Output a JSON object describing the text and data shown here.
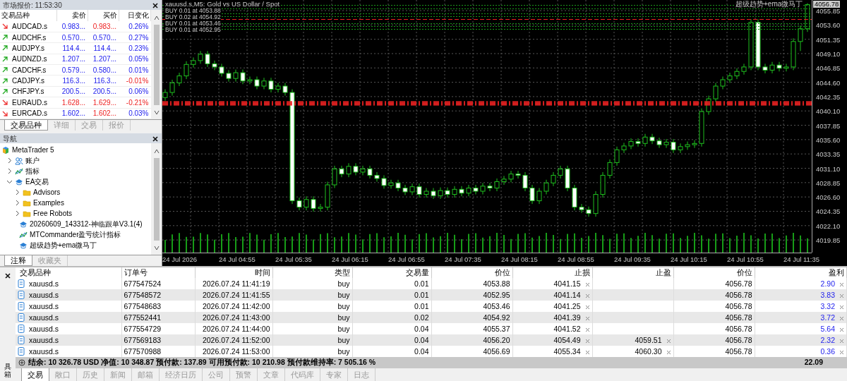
{
  "market_watch": {
    "title": "市场报价: 11:53:30",
    "columns": [
      "交易品种",
      "卖价",
      "买价",
      "日变化"
    ],
    "rows": [
      {
        "symbol": "AUDCAD.s",
        "falling": true,
        "bid": "0.983...",
        "bid_down": false,
        "ask": "0.983...",
        "ask_down": true,
        "change": "0.26%",
        "change_down": false
      },
      {
        "symbol": "AUDCHF.s",
        "falling": false,
        "bid": "0.570...",
        "bid_down": false,
        "ask": "0.570...",
        "ask_down": false,
        "change": "0.27%",
        "change_down": false
      },
      {
        "symbol": "AUDJPY.s",
        "falling": false,
        "bid": "114.4...",
        "bid_down": false,
        "ask": "114.4...",
        "ask_down": false,
        "change": "0.23%",
        "change_down": false
      },
      {
        "symbol": "AUDNZD.s",
        "falling": false,
        "bid": "1.207...",
        "bid_down": false,
        "ask": "1.207...",
        "ask_down": false,
        "change": "0.05%",
        "change_down": false
      },
      {
        "symbol": "CADCHF.s",
        "falling": false,
        "bid": "0.579...",
        "bid_down": false,
        "ask": "0.580...",
        "ask_down": false,
        "change": "0.01%",
        "change_down": false
      },
      {
        "symbol": "CADJPY.s",
        "falling": false,
        "bid": "116.3...",
        "bid_down": false,
        "ask": "116.3...",
        "ask_down": false,
        "change": "-0.01%",
        "change_down": true
      },
      {
        "symbol": "CHFJPY.s",
        "falling": false,
        "bid": "200.5...",
        "bid_down": false,
        "ask": "200.5...",
        "ask_down": false,
        "change": "0.06%",
        "change_down": false
      },
      {
        "symbol": "EURAUD.s",
        "falling": true,
        "bid": "1.628...",
        "bid_down": true,
        "ask": "1.629...",
        "ask_down": true,
        "change": "-0.21%",
        "change_down": true
      },
      {
        "symbol": "EURCAD.s",
        "falling": true,
        "bid": "1.602...",
        "bid_down": false,
        "ask": "1.602...",
        "ask_down": true,
        "change": "0.03%",
        "change_down": false
      }
    ],
    "tabs": [
      {
        "label": "交易品种",
        "selected": true
      },
      {
        "label": "详细",
        "selected": false
      },
      {
        "label": "交易",
        "selected": false
      },
      {
        "label": "报价",
        "selected": false
      }
    ]
  },
  "navigator": {
    "title": "导航",
    "tree": [
      {
        "label": "MetaTrader 5",
        "kind": "root",
        "children": [
          {
            "label": "账户",
            "kind": "accounts",
            "expanded": false
          },
          {
            "label": "指标",
            "kind": "indicator",
            "expanded": false
          },
          {
            "label": "EA交易",
            "kind": "expert",
            "expanded": true,
            "children": [
              {
                "label": "Advisors",
                "kind": "folder",
                "expanded": false
              },
              {
                "label": "Examples",
                "kind": "folder",
                "expanded": false
              },
              {
                "label": "Free Robots",
                "kind": "folder",
                "expanded": false
              },
              {
                "label": "20260609_143312-神临跟单V3.1(4)",
                "kind": "expert"
              },
              {
                "label": "MTCommander盈亏统计指标",
                "kind": "indicator"
              },
              {
                "label": "超级趋势+ema微马丁",
                "kind": "expert"
              }
            ]
          }
        ]
      }
    ],
    "tabs": [
      {
        "label": "注释",
        "selected": true
      },
      {
        "label": "收藏夹",
        "selected": false
      }
    ]
  },
  "chart": {
    "title": "xauusd.s,M5: Gold vs US Dollar / Spot",
    "trade_labels": [
      "BUY 0.01 at 4053.88",
      "BUY 0.02 at 4054.92",
      "BUY 0.01 at 4053.46",
      "BUY 0.01 at 4052.95"
    ],
    "expert_name": "超级趋势+ema微马丁",
    "price_tag": "4056.78",
    "time_labels": [
      "24 Jul 2026",
      "24 Jul 04:55",
      "24 Jul 05:35",
      "24 Jul 06:15",
      "24 Jul 06:55",
      "24 Jul 07:35",
      "24 Jul 08:15",
      "24 Jul 08:55",
      "24 Jul 09:35",
      "24 Jul 10:15",
      "24 Jul 10:55",
      "24 Jul 11:35"
    ],
    "chart_data": {
      "type": "candlestick",
      "grid": true,
      "ylim": [
        4017.87,
        4057.51
      ],
      "yticks": [
        {
          "value": 4055.85,
          "label": "4055.85"
        },
        {
          "value": 4053.6,
          "label": "4053.60"
        },
        {
          "value": 4051.35,
          "label": "4051.35"
        },
        {
          "value": 4049.1,
          "label": "4049.10"
        },
        {
          "value": 4046.85,
          "label": "4046.85"
        },
        {
          "value": 4044.6,
          "label": "4044.60"
        },
        {
          "value": 4042.35,
          "label": "4042.35"
        },
        {
          "value": 4040.1,
          "label": "4040.10"
        },
        {
          "value": 4037.85,
          "label": "4037.85"
        },
        {
          "value": 4035.6,
          "label": "4035.60"
        },
        {
          "value": 4033.35,
          "label": "4033.35"
        },
        {
          "value": 4031.1,
          "label": "4031.10"
        },
        {
          "value": 4028.85,
          "label": "4028.85"
        },
        {
          "value": 4026.6,
          "label": "4026.60"
        },
        {
          "value": 4024.35,
          "label": "4024.35"
        },
        {
          "value": 4022.1,
          "label": "4022.10"
        },
        {
          "value": 4019.85,
          "label": "4019.85"
        }
      ],
      "ohlc": [
        [
          4042.2,
          4043.5,
          4041.7,
          4043.0
        ],
        [
          4043.0,
          4045.0,
          4042.5,
          4044.5
        ],
        [
          4044.5,
          4046.1,
          4044.0,
          4045.6
        ],
        [
          4045.6,
          4047.9,
          4045.1,
          4047.4
        ],
        [
          4047.4,
          4048.5,
          4046.9,
          4048.0
        ],
        [
          4048.0,
          4049.5,
          4047.5,
          4049.0
        ],
        [
          4049.0,
          4049.5,
          4047.0,
          4047.5
        ],
        [
          4047.5,
          4048.0,
          4046.5,
          4047.0
        ],
        [
          4047.0,
          4047.5,
          4045.5,
          4046.0
        ],
        [
          4046.0,
          4046.5,
          4044.7,
          4045.2
        ],
        [
          4045.2,
          4046.6,
          4044.7,
          4046.1
        ],
        [
          4046.1,
          4046.6,
          4044.3,
          4044.8
        ],
        [
          4044.8,
          4045.5,
          4044.3,
          4045.0
        ],
        [
          4045.0,
          4045.5,
          4043.5,
          4044.0
        ],
        [
          4044.0,
          4045.3,
          4043.5,
          4044.8
        ],
        [
          4044.8,
          4045.3,
          4043.0,
          4043.5
        ],
        [
          4043.5,
          4044.5,
          4043.0,
          4044.0
        ],
        [
          4044.0,
          4044.5,
          4042.5,
          4043.0
        ],
        [
          4043.0,
          4043.5,
          4025.5,
          4026.0
        ],
        [
          4026.0,
          4026.5,
          4024.5,
          4025.0
        ],
        [
          4025.0,
          4026.7,
          4024.5,
          4026.2
        ],
        [
          4026.2,
          4026.7,
          4024.3,
          4024.8
        ],
        [
          4024.8,
          4025.5,
          4024.3,
          4025.0
        ],
        [
          4025.0,
          4029.0,
          4024.5,
          4028.5
        ],
        [
          4028.5,
          4031.5,
          4028.0,
          4031.0
        ],
        [
          4031.0,
          4031.5,
          4029.7,
          4030.2
        ],
        [
          4030.2,
          4031.9,
          4029.7,
          4031.4
        ],
        [
          4031.4,
          4031.9,
          4030.0,
          4030.5
        ],
        [
          4030.5,
          4031.5,
          4030.0,
          4031.0
        ],
        [
          4031.0,
          4031.5,
          4029.5,
          4030.0
        ],
        [
          4030.0,
          4030.5,
          4029.0,
          4029.5
        ],
        [
          4029.5,
          4030.0,
          4027.9,
          4028.4
        ],
        [
          4028.4,
          4029.3,
          4027.9,
          4028.8
        ],
        [
          4028.8,
          4029.3,
          4027.5,
          4028.0
        ],
        [
          4028.0,
          4028.5,
          4026.9,
          4027.4
        ],
        [
          4027.4,
          4028.7,
          4026.9,
          4028.2
        ],
        [
          4028.2,
          4028.7,
          4026.5,
          4027.0
        ],
        [
          4027.0,
          4028.0,
          4026.5,
          4027.5
        ],
        [
          4027.5,
          4028.0,
          4026.3,
          4026.8
        ],
        [
          4026.8,
          4028.1,
          4026.3,
          4027.6
        ],
        [
          4027.6,
          4028.1,
          4026.5,
          4027.0
        ],
        [
          4027.0,
          4028.3,
          4026.5,
          4027.8
        ],
        [
          4027.8,
          4028.3,
          4026.7,
          4027.2
        ],
        [
          4027.2,
          4028.5,
          4026.7,
          4028.0
        ],
        [
          4028.0,
          4028.5,
          4027.0,
          4027.5
        ],
        [
          4027.5,
          4028.8,
          4027.0,
          4028.3
        ],
        [
          4028.3,
          4028.8,
          4027.5,
          4028.0
        ],
        [
          4028.0,
          4029.5,
          4027.5,
          4029.0
        ],
        [
          4029.0,
          4029.9,
          4028.5,
          4029.4
        ],
        [
          4029.4,
          4030.7,
          4028.9,
          4030.2
        ],
        [
          4030.2,
          4030.7,
          4029.5,
          4030.0
        ],
        [
          4030.0,
          4030.5,
          4027.5,
          4028.0
        ],
        [
          4028.0,
          4028.5,
          4025.5,
          4026.0
        ],
        [
          4026.0,
          4028.0,
          4025.5,
          4027.5
        ],
        [
          4027.5,
          4029.3,
          4027.0,
          4028.8
        ],
        [
          4028.8,
          4030.5,
          4028.3,
          4030.0
        ],
        [
          4030.0,
          4031.5,
          4029.5,
          4031.0
        ],
        [
          4031.0,
          4031.5,
          4027.5,
          4028.0
        ],
        [
          4028.0,
          4028.5,
          4024.5,
          4025.0
        ],
        [
          4025.0,
          4025.5,
          4024.1,
          4024.6
        ],
        [
          4024.6,
          4025.1,
          4023.5,
          4024.0
        ],
        [
          4024.0,
          4027.5,
          4023.5,
          4027.0
        ],
        [
          4027.0,
          4030.5,
          4026.5,
          4030.0
        ],
        [
          4030.0,
          4032.5,
          4029.5,
          4032.0
        ],
        [
          4032.0,
          4034.5,
          4031.5,
          4034.0
        ],
        [
          4034.0,
          4035.1,
          4033.5,
          4034.6
        ],
        [
          4034.6,
          4035.8,
          4034.1,
          4035.3
        ],
        [
          4035.3,
          4035.8,
          4034.5,
          4035.0
        ],
        [
          4035.0,
          4036.5,
          4034.5,
          4036.0
        ],
        [
          4036.0,
          4036.5,
          4034.9,
          4035.4
        ],
        [
          4035.4,
          4035.9,
          4034.3,
          4034.8
        ],
        [
          4034.8,
          4035.7,
          4034.3,
          4035.2
        ],
        [
          4035.2,
          4035.7,
          4033.5,
          4034.0
        ],
        [
          4034.0,
          4035.0,
          4033.5,
          4034.5
        ],
        [
          4034.5,
          4035.3,
          4034.0,
          4034.8
        ],
        [
          4034.8,
          4035.5,
          4034.3,
          4035.0
        ],
        [
          4035.0,
          4040.5,
          4034.5,
          4040.0
        ],
        [
          4040.0,
          4042.5,
          4039.5,
          4042.0
        ],
        [
          4042.0,
          4044.5,
          4041.5,
          4044.0
        ],
        [
          4044.0,
          4045.5,
          4043.5,
          4045.0
        ],
        [
          4045.0,
          4046.1,
          4044.5,
          4045.6
        ],
        [
          4045.6,
          4046.8,
          4045.1,
          4046.3
        ],
        [
          4046.3,
          4047.5,
          4045.8,
          4047.0
        ],
        [
          4047.0,
          4054.5,
          4046.5,
          4054.0
        ],
        [
          4054.0,
          4054.5,
          4046.5,
          4047.0
        ],
        [
          4047.0,
          4047.5,
          4046.0,
          4046.5
        ],
        [
          4046.5,
          4047.8,
          4046.0,
          4047.3
        ],
        [
          4047.3,
          4047.8,
          4046.3,
          4046.8
        ],
        [
          4046.8,
          4047.5,
          4046.3,
          4047.0
        ],
        [
          4047.0,
          4051.5,
          4046.5,
          4051.0
        ],
        [
          4051.0,
          4053.5,
          4049.5,
          4053.0
        ],
        [
          4053.0,
          4057.0,
          4052.5,
          4056.78
        ]
      ]
    }
  },
  "toolbox": {
    "side_label": "具箱",
    "columns": [
      "交易品种",
      "订单号",
      "时间",
      "类型",
      "交易量",
      "价位",
      "止损",
      "止盈",
      "价位",
      "盈利"
    ],
    "rows": [
      {
        "symbol": "xauusd.s",
        "order": "677547524",
        "time": "2026.07.24 11:41:19",
        "type": "buy",
        "volume": "0.01",
        "price": "4053.88",
        "sl": "4041.15",
        "current": "4056.78",
        "profit": "2.90"
      },
      {
        "symbol": "xauusd.s",
        "order": "677548572",
        "time": "2026.07.24 11:41:55",
        "type": "buy",
        "volume": "0.01",
        "price": "4052.95",
        "sl": "4041.14",
        "current": "4056.78",
        "profit": "3.83"
      },
      {
        "symbol": "xauusd.s",
        "order": "677548683",
        "time": "2026.07.24 11:42:00",
        "type": "buy",
        "volume": "0.01",
        "price": "4053.46",
        "sl": "4041.25",
        "current": "4056.78",
        "profit": "3.32"
      },
      {
        "symbol": "xauusd.s",
        "order": "677552441",
        "time": "2026.07.24 11:43:00",
        "type": "buy",
        "volume": "0.02",
        "price": "4054.92",
        "sl": "4041.39",
        "current": "4056.78",
        "profit": "3.72"
      },
      {
        "symbol": "xauusd.s",
        "order": "677554729",
        "time": "2026.07.24 11:44:00",
        "type": "buy",
        "volume": "0.04",
        "price": "4055.37",
        "sl": "4041.52",
        "current": "4056.78",
        "profit": "5.64"
      },
      {
        "symbol": "xauusd.s",
        "order": "677569183",
        "time": "2026.07.24 11:52:00",
        "type": "buy",
        "volume": "0.04",
        "price": "4056.20",
        "sl": "4054.49",
        "tp": "4059.51",
        "current": "4056.78",
        "profit": "2.32"
      },
      {
        "symbol": "xauusd.s",
        "order": "677570988",
        "time": "2026.07.24 11:53:00",
        "type": "buy",
        "volume": "0.04",
        "price": "4056.69",
        "sl": "4055.34",
        "tp": "4060.30",
        "current": "4056.78",
        "profit": "0.36"
      }
    ],
    "summary": "结余: 10 326.78 USD  净值: 10 348.87  预付款: 137.89  可用预付款: 10 210.98  预付款维持率: 7 505.16 %",
    "total_profit": "22.09",
    "tabs": [
      {
        "label": "交易",
        "selected": true
      },
      {
        "label": "敞口",
        "selected": false
      },
      {
        "label": "历史",
        "selected": false
      },
      {
        "label": "新闻",
        "selected": false
      },
      {
        "label": "邮箱",
        "selected": false
      },
      {
        "label": "经济日历",
        "selected": false
      },
      {
        "label": "公司",
        "selected": false
      },
      {
        "label": "预警",
        "selected": false
      },
      {
        "label": "文章",
        "selected": false
      },
      {
        "label": "代码库",
        "selected": false
      },
      {
        "label": "专家",
        "selected": false
      },
      {
        "label": "日志",
        "selected": false
      }
    ]
  }
}
